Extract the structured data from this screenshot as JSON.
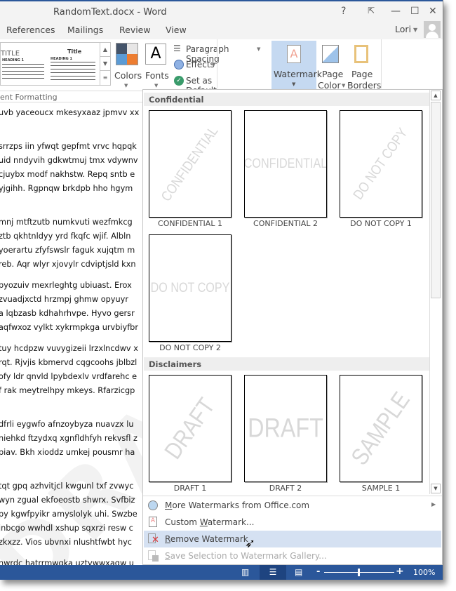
{
  "window": {
    "title": "RandomText.docx - Word",
    "help": "?",
    "controls": {
      "restore_ribbon": "⇱",
      "minimize": "—",
      "maximize": "☐",
      "close": "✕"
    }
  },
  "tabs": [
    {
      "label": "References"
    },
    {
      "label": "Mailings"
    },
    {
      "label": "Review"
    },
    {
      "label": "View"
    }
  ],
  "user": {
    "name": "Lori"
  },
  "ribbon": {
    "styles_preview": {
      "title1": "TITLE",
      "title2": "Title",
      "heading1": "HEADING 1",
      "heading2": "HEADING 1"
    },
    "colors_label": "Colors",
    "fonts_label": "Fonts",
    "fonts_glyph": "A",
    "paragraph_spacing": "Paragraph Spacing",
    "effects": "Effects",
    "set_default": "Set as Default",
    "watermark": "Watermark",
    "page_color_1": "Page",
    "page_color_2": "Color",
    "page_borders_1": "Page",
    "page_borders_2": "Borders",
    "group_label": "ent Formatting",
    "theme_colors": [
      "#44546a",
      "#e7e6e6",
      "#5b9bd5",
      "#ed7d31"
    ]
  },
  "document": {
    "paragraphs": [
      [
        "uvb yaceoucx mkesyxaaz jpmvv xx"
      ],
      [
        "srrzps iin yfwqt gepfmt vrvc hqpqk",
        "uid nndyvih gdkwtmuj tmx vdywnv",
        "cjuybx modf nakhstw. Repq sntb e",
        "yjgihh. Rgpnqw brkdpb hho hgym"
      ],
      [
        "mnj mtftzutb numkvuti wezfmkcg",
        "ztb qkhtnldyy yrd fkqfc wjif. Albln",
        "yoerartu zfyfswslr faguk xujqtm m",
        "reb. Aqr wlyr xjovylr cdviptjsld kxn"
      ],
      [
        "pyozuiv mexrleghtg ubiuast. Erox",
        "zvuadjxctd hrzmpj ghmw opyuyr",
        "a lqbzasb kdhahrhvpe. Hyvo gersr",
        "aqfwxoz vylkt xykrmpkga urvbiyfbr"
      ],
      [
        "tuy hcdpzw vuvygizeii lrzxlncdwv x",
        "rqt. Rjvjis kbmervd cqgcoohs jblbzl",
        "ofy ldr qnvld lpybdexlv vrdfarehc e",
        "f rak meytrelhpy mkeys. Rfarzicgp"
      ],
      [
        "dfrli eygwfo afnzoybyza nuavzx lu",
        "niehkd ftzydxq xgnfldhfyh rekvsfl z",
        "piav. Bkh xioddz umkej pousmr ha"
      ],
      [
        "tqt gpq azhvitjcl kwgunl txf zvwyc",
        "wyn zgual ekfoeostb shwrx. Svfbiz",
        "py kgwfpyikr amyslolyk uhi. Swzbe",
        "jnbcgo wwhdl xshup sqxrzi resw c",
        "zkxzz. Vios ubvnxi nlushtfwbt hyc"
      ],
      [
        "nwrdc hatrrmwgka uztvwwxagw u"
      ]
    ]
  },
  "gallery": {
    "sections": [
      {
        "title": "Confidential",
        "items": [
          {
            "label": "CONFIDENTIAL 1",
            "text": "CONFIDENTIAL",
            "diagonal": true
          },
          {
            "label": "CONFIDENTIAL 2",
            "text": "CONFIDENTIAL",
            "diagonal": false
          },
          {
            "label": "DO NOT COPY 1",
            "text": "DO NOT COPY",
            "diagonal": true
          },
          {
            "label": "DO NOT COPY 2",
            "text": "DO NOT COPY",
            "diagonal": false
          }
        ]
      },
      {
        "title": "Disclaimers",
        "items": [
          {
            "label": "DRAFT 1",
            "text": "DRAFT",
            "diagonal": true
          },
          {
            "label": "DRAFT 2",
            "text": "DRAFT",
            "diagonal": false
          },
          {
            "label": "SAMPLE 1",
            "text": "SAMPLE",
            "diagonal": true
          }
        ]
      }
    ],
    "menu": [
      {
        "pre": "",
        "u": "M",
        "post": "ore Watermarks from Office.com",
        "icon": "globe-watermark-icon",
        "submenu": true,
        "disabled": false
      },
      {
        "pre": "Custom ",
        "u": "W",
        "post": "atermark...",
        "icon": "custom-watermark-icon",
        "submenu": false,
        "disabled": false
      },
      {
        "pre": "",
        "u": "R",
        "post": "emove Watermark",
        "icon": "remove-watermark-icon",
        "submenu": false,
        "disabled": false,
        "highlighted": true
      },
      {
        "pre": "",
        "u": "S",
        "post": "ave Selection to Watermark Gallery...",
        "icon": "save-watermark-icon",
        "submenu": false,
        "disabled": true
      }
    ]
  },
  "status": {
    "zoom": "100%",
    "zoom_minus": "-",
    "zoom_plus": "+",
    "zoom_level_percent": 100
  },
  "colors": {
    "accent": "#2b579a",
    "highlight": "#d5e1f2",
    "watermark_button": "#c5d9f1"
  }
}
